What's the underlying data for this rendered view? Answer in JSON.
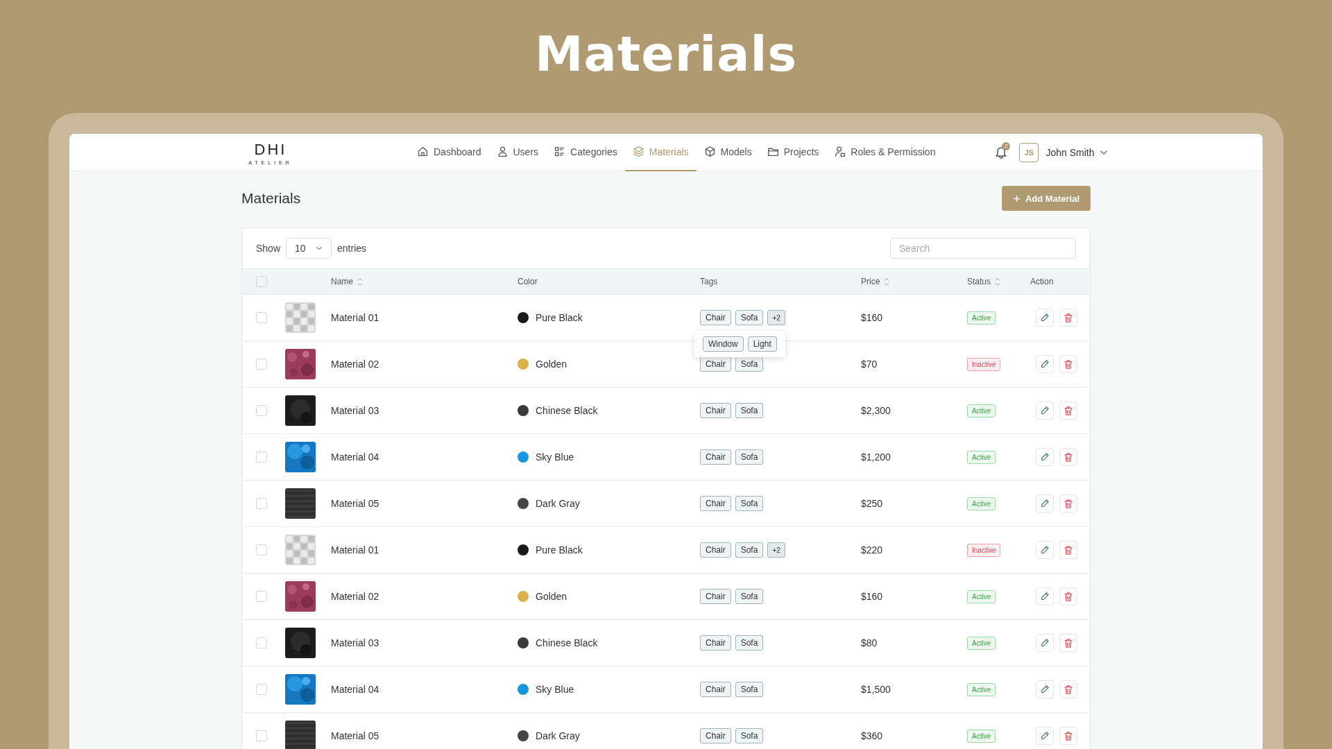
{
  "banner_title": "Materials",
  "logo": {
    "text": "DHI",
    "subtitle": "ATELIER"
  },
  "nav": [
    {
      "label": "Dashboard",
      "selected": false
    },
    {
      "label": "Users",
      "selected": false
    },
    {
      "label": "Categories",
      "selected": false
    },
    {
      "label": "Materials",
      "selected": true
    },
    {
      "label": "Models",
      "selected": false
    },
    {
      "label": "Projects",
      "selected": false
    },
    {
      "label": "Roles & Permission",
      "selected": false
    }
  ],
  "notifications": {
    "count": "2"
  },
  "user": {
    "initials": "JS",
    "name": "John Smith"
  },
  "page_title": "Materials",
  "add_button": "Add Material",
  "show": {
    "label": "Show",
    "value": "10",
    "suffix": "entries"
  },
  "search": {
    "placeholder": "Search"
  },
  "select_all": {
    "checked": false
  },
  "columns": [
    {
      "label": "Name",
      "sortable": true
    },
    {
      "label": "Color",
      "sortable": false
    },
    {
      "label": "Tags",
      "sortable": false
    },
    {
      "label": "Price",
      "sortable": true
    },
    {
      "label": "Status",
      "sortable": true
    },
    {
      "label": "Action",
      "sortable": false
    }
  ],
  "rows": [
    {
      "selected": false,
      "name": "Material 01",
      "color": {
        "label": "Pure Black",
        "color": "#1a1a1a"
      },
      "tags": [
        "Chair",
        "Sofa"
      ],
      "more": {
        "label": "+2",
        "tags": [
          "Window",
          "Light"
        ]
      },
      "price": "$160",
      "status": {
        "label": "Active",
        "active": true
      }
    },
    {
      "selected": false,
      "name": "Material 02",
      "color": {
        "label": "Golden",
        "color": "#d8b448"
      },
      "tags": [
        "Chair",
        "Sofa"
      ],
      "price": "$70",
      "status": {
        "label": "Inactive",
        "active": false
      }
    },
    {
      "selected": false,
      "name": "Material 03",
      "color": {
        "label": "Chinese Black",
        "color": "#3a3a3a"
      },
      "tags": [
        "Chair",
        "Sofa"
      ],
      "price": "$2,300",
      "status": {
        "label": "Active",
        "active": true
      }
    },
    {
      "selected": false,
      "name": "Material 04",
      "color": {
        "label": "Sky Blue",
        "color": "#1a96dc"
      },
      "tags": [
        "Chair",
        "Sofa"
      ],
      "price": "$1,200",
      "status": {
        "label": "Active",
        "active": true
      }
    },
    {
      "selected": false,
      "name": "Material 05",
      "color": {
        "label": "Dark Gray",
        "color": "#454545"
      },
      "tags": [
        "Chair",
        "Sofa"
      ],
      "price": "$250",
      "status": {
        "label": "Active",
        "active": true
      }
    },
    {
      "selected": false,
      "name": "Material 01",
      "color": {
        "label": "Pure Black",
        "color": "#1a1a1a"
      },
      "tags": [
        "Chair",
        "Sofa"
      ],
      "more": {
        "label": "+2"
      },
      "price": "$220",
      "status": {
        "label": "Inactive",
        "active": false
      }
    },
    {
      "selected": false,
      "name": "Material 02",
      "color": {
        "label": "Golden",
        "color": "#d8b448"
      },
      "tags": [
        "Chair",
        "Sofa"
      ],
      "price": "$160",
      "status": {
        "label": "Active",
        "active": true
      }
    },
    {
      "selected": false,
      "name": "Material 03",
      "color": {
        "label": "Chinese Black",
        "color": "#3a3a3a"
      },
      "tags": [
        "Chair",
        "Sofa"
      ],
      "price": "$80",
      "status": {
        "label": "Active",
        "active": true
      }
    },
    {
      "selected": false,
      "name": "Material 04",
      "color": {
        "label": "Sky Blue",
        "color": "#1a96dc"
      },
      "tags": [
        "Chair",
        "Sofa"
      ],
      "price": "$1,500",
      "status": {
        "label": "Active",
        "active": true
      }
    },
    {
      "selected": false,
      "name": "Material 05",
      "color": {
        "label": "Dark Gray",
        "color": "#454545"
      },
      "tags": [
        "Chair",
        "Sofa"
      ],
      "price": "$360",
      "status": {
        "label": "Active",
        "active": true
      }
    }
  ]
}
